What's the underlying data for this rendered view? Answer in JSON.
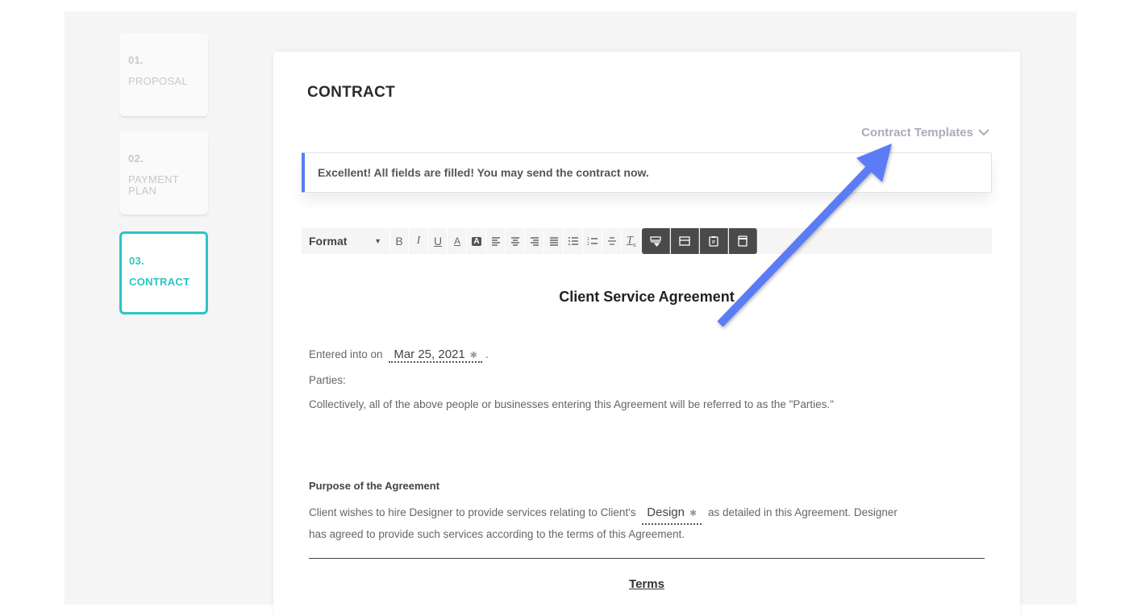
{
  "steps": [
    {
      "number": "01.",
      "label": "PROPOSAL",
      "active": false
    },
    {
      "number": "02.",
      "label": "PAYMENT PLAN",
      "active": false
    },
    {
      "number": "03.",
      "label": "CONTRACT",
      "active": true
    }
  ],
  "card": {
    "title": "CONTRACT",
    "templates_dropdown": "Contract Templates",
    "alert": "Excellent! All fields are filled! You may send the contract now."
  },
  "toolbar": {
    "format_label": "Format",
    "buttons": [
      "bold",
      "italic",
      "underline",
      "text-color",
      "background-color",
      "align-left",
      "align-center",
      "align-right",
      "align-justify",
      "bulleted-list",
      "numbered-list",
      "strikethrough",
      "clear-formatting"
    ],
    "dark_buttons": [
      "insert-field",
      "insert-block",
      "clipboard",
      "page"
    ]
  },
  "document": {
    "title": "Client Service Agreement",
    "entered_prefix": "Entered into on",
    "date_value": "Mar 25, 2021",
    "entered_suffix": ".",
    "parties_label": "Parties:",
    "collective_text": "Collectively, all of the above people or businesses entering this Agreement will be referred to as the \"Parties.\"",
    "purpose_heading": "Purpose of the Agreement",
    "purpose_prefix": "Client wishes to hire Designer to provide services relating to Client's",
    "service_value": "Design",
    "purpose_suffix": "as detailed in this Agreement. Designer has agreed to provide such services according to the terms of this Agreement.",
    "terms_heading": "Terms"
  },
  "annotation": {
    "type": "arrow",
    "color": "#5b7cf5",
    "points_to": "Contract Templates"
  }
}
